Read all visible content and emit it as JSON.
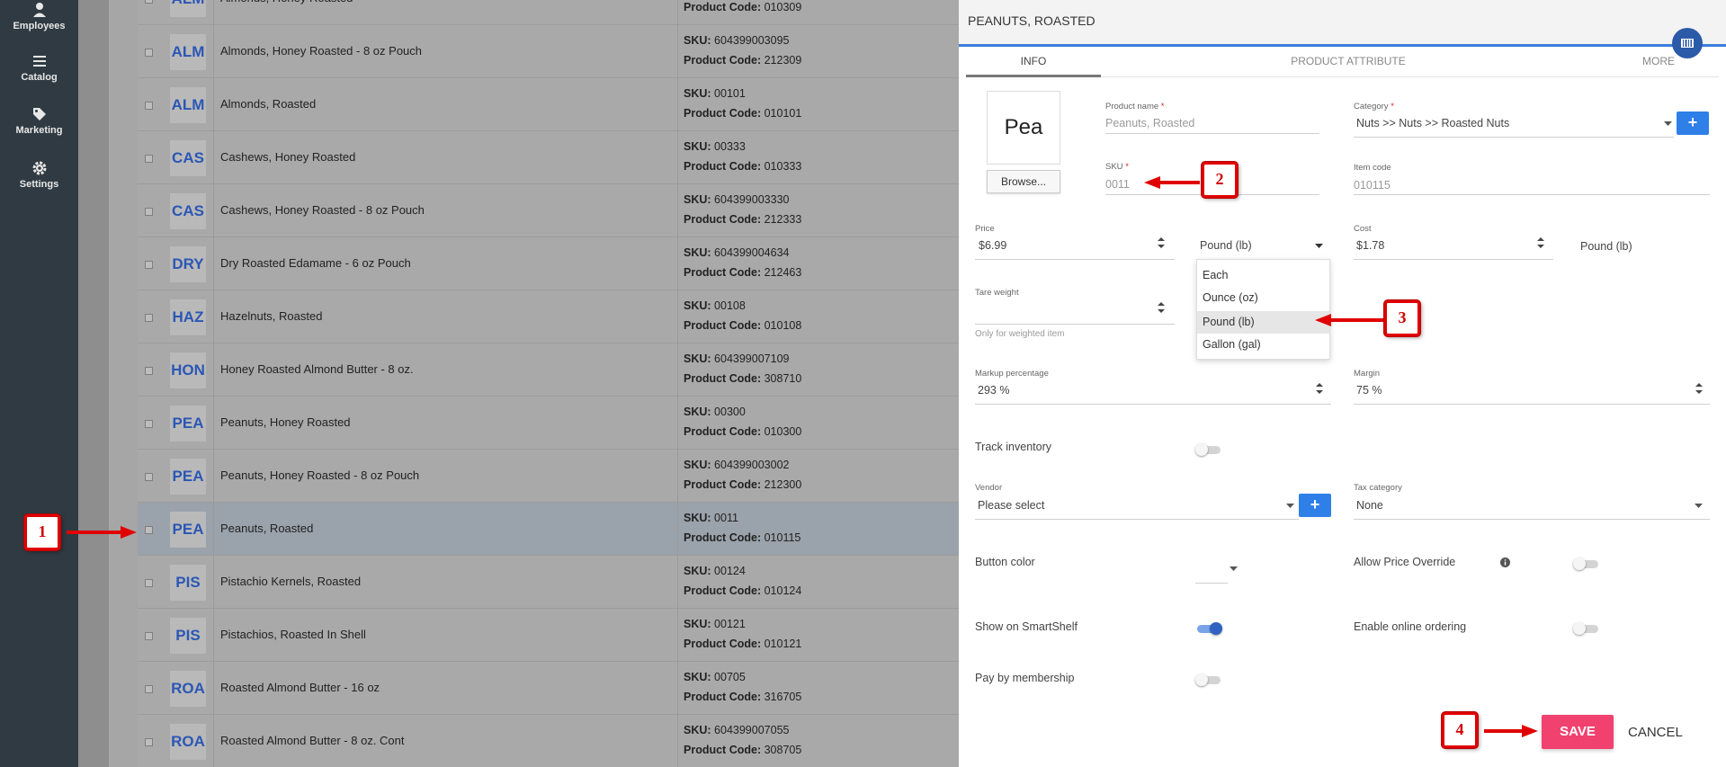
{
  "sidebar": {
    "items": [
      {
        "label": "Employees",
        "icon": "person-icon"
      },
      {
        "label": "Catalog",
        "icon": "list-icon"
      },
      {
        "label": "Marketing",
        "icon": "tag-icon"
      },
      {
        "label": "Settings",
        "icon": "gear-icon"
      }
    ]
  },
  "list": {
    "sku_label": "SKU:",
    "code_label": "Product Code:",
    "rows": [
      {
        "badge": "ALM",
        "name": "Almonds, Honey Roasted",
        "sku": "",
        "code": "010309"
      },
      {
        "badge": "ALM",
        "name": "Almonds, Honey Roasted - 8 oz Pouch",
        "sku": "604399003095",
        "code": "212309"
      },
      {
        "badge": "ALM",
        "name": "Almonds, Roasted",
        "sku": "00101",
        "code": "010101"
      },
      {
        "badge": "CAS",
        "name": "Cashews, Honey Roasted",
        "sku": "00333",
        "code": "010333"
      },
      {
        "badge": "CAS",
        "name": "Cashews, Honey Roasted - 8 oz Pouch",
        "sku": "604399003330",
        "code": "212333"
      },
      {
        "badge": "DRY",
        "name": "Dry Roasted Edamame - 6 oz Pouch",
        "sku": "604399004634",
        "code": "212463"
      },
      {
        "badge": "HAZ",
        "name": "Hazelnuts, Roasted",
        "sku": "00108",
        "code": "010108"
      },
      {
        "badge": "HON",
        "name": "Honey Roasted Almond Butter - 8 oz.",
        "sku": "604399007109",
        "code": "308710"
      },
      {
        "badge": "PEA",
        "name": "Peanuts, Honey Roasted",
        "sku": "00300",
        "code": "010300"
      },
      {
        "badge": "PEA",
        "name": "Peanuts, Honey Roasted - 8 oz Pouch",
        "sku": "604399003002",
        "code": "212300"
      },
      {
        "badge": "PEA",
        "name": "Peanuts, Roasted",
        "sku": "0011",
        "code": "010115"
      },
      {
        "badge": "PIS",
        "name": "Pistachio Kernels, Roasted",
        "sku": "00124",
        "code": "010124"
      },
      {
        "badge": "PIS",
        "name": "Pistachios, Roasted In Shell",
        "sku": "00121",
        "code": "010121"
      },
      {
        "badge": "ROA",
        "name": "Roasted Almond Butter - 16 oz",
        "sku": "00705",
        "code": "316705"
      },
      {
        "badge": "ROA",
        "name": "Roasted Almond Butter - 8 oz. Cont",
        "sku": "604399007055",
        "code": "308705"
      }
    ]
  },
  "panel": {
    "title": "PEANUTS, ROASTED",
    "tabs": [
      "INFO",
      "PRODUCT ATTRIBUTE",
      "MORE"
    ],
    "image_text": "Pea",
    "browse_label": "Browse...",
    "product_name": {
      "label": "Product name",
      "value": "Peanuts, Roasted"
    },
    "category": {
      "label": "Category",
      "value": "Nuts >> Nuts >> Roasted Nuts"
    },
    "sku": {
      "label": "SKU",
      "value": "0011"
    },
    "item_code": {
      "label": "Item code",
      "value": "010115"
    },
    "price": {
      "label": "Price",
      "value": "$6.99"
    },
    "unit": {
      "value": "Pound (lb)",
      "options": [
        "Each",
        "Ounce (oz)",
        "Pound (lb)",
        "Gallon (gal)"
      ]
    },
    "cost": {
      "label": "Cost",
      "value": "$1.78",
      "unit": "Pound (lb)"
    },
    "tare": {
      "label": "Tare weight",
      "note": "Only for weighted item"
    },
    "markup": {
      "label": "Markup percentage",
      "value": "293 %"
    },
    "margin": {
      "label": "Margin",
      "value": "75 %"
    },
    "track_inventory": {
      "label": "Track inventory",
      "on": false
    },
    "vendor": {
      "label": "Vendor",
      "value": "Please select"
    },
    "tax_category": {
      "label": "Tax category",
      "value": "None"
    },
    "button_color": {
      "label": "Button color"
    },
    "allow_price_override": {
      "label": "Allow Price Override",
      "on": false
    },
    "show_smartshelf": {
      "label": "Show on SmartShelf",
      "on": true
    },
    "online_ordering": {
      "label": "Enable online ordering",
      "on": false
    },
    "pay_membership": {
      "label": "Pay by membership",
      "on": false
    },
    "required_mark": "*",
    "plus_symbol": "+",
    "save_label": "SAVE",
    "cancel_label": "CANCEL"
  },
  "annotations": [
    "1",
    "2",
    "3",
    "4"
  ],
  "colors": {
    "accent": "#3b7ddd",
    "save": "#f1416f",
    "callout": "#e00000",
    "badge_text": "#2b57b5"
  }
}
